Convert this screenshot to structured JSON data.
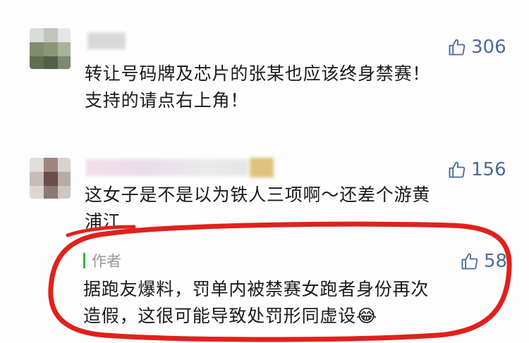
{
  "comments": [
    {
      "likes": "306",
      "lines": [
        "转让号码牌及芯片的张某也应该终身禁赛！",
        "支持的请点右上角！"
      ]
    },
    {
      "likes": "156",
      "lines": [
        "这女子是不是以为铁人三项啊～还差个游黄",
        "浦江"
      ],
      "reply": {
        "author_label": "作者",
        "likes": "58",
        "lines": [
          "据跑友爆料，罚单内被禁赛女跑者身份再次",
          "造假，这很可能导致处罚形同虚设"
        ],
        "emoji": "😂"
      }
    }
  ],
  "colors": {
    "like": "#4a6b9a",
    "text": "#1a1a1a",
    "author": "#999999",
    "author_bar": "#3cb04a",
    "annotation": "#e0211c"
  },
  "icons": {
    "like": "thumbs-up-icon"
  }
}
